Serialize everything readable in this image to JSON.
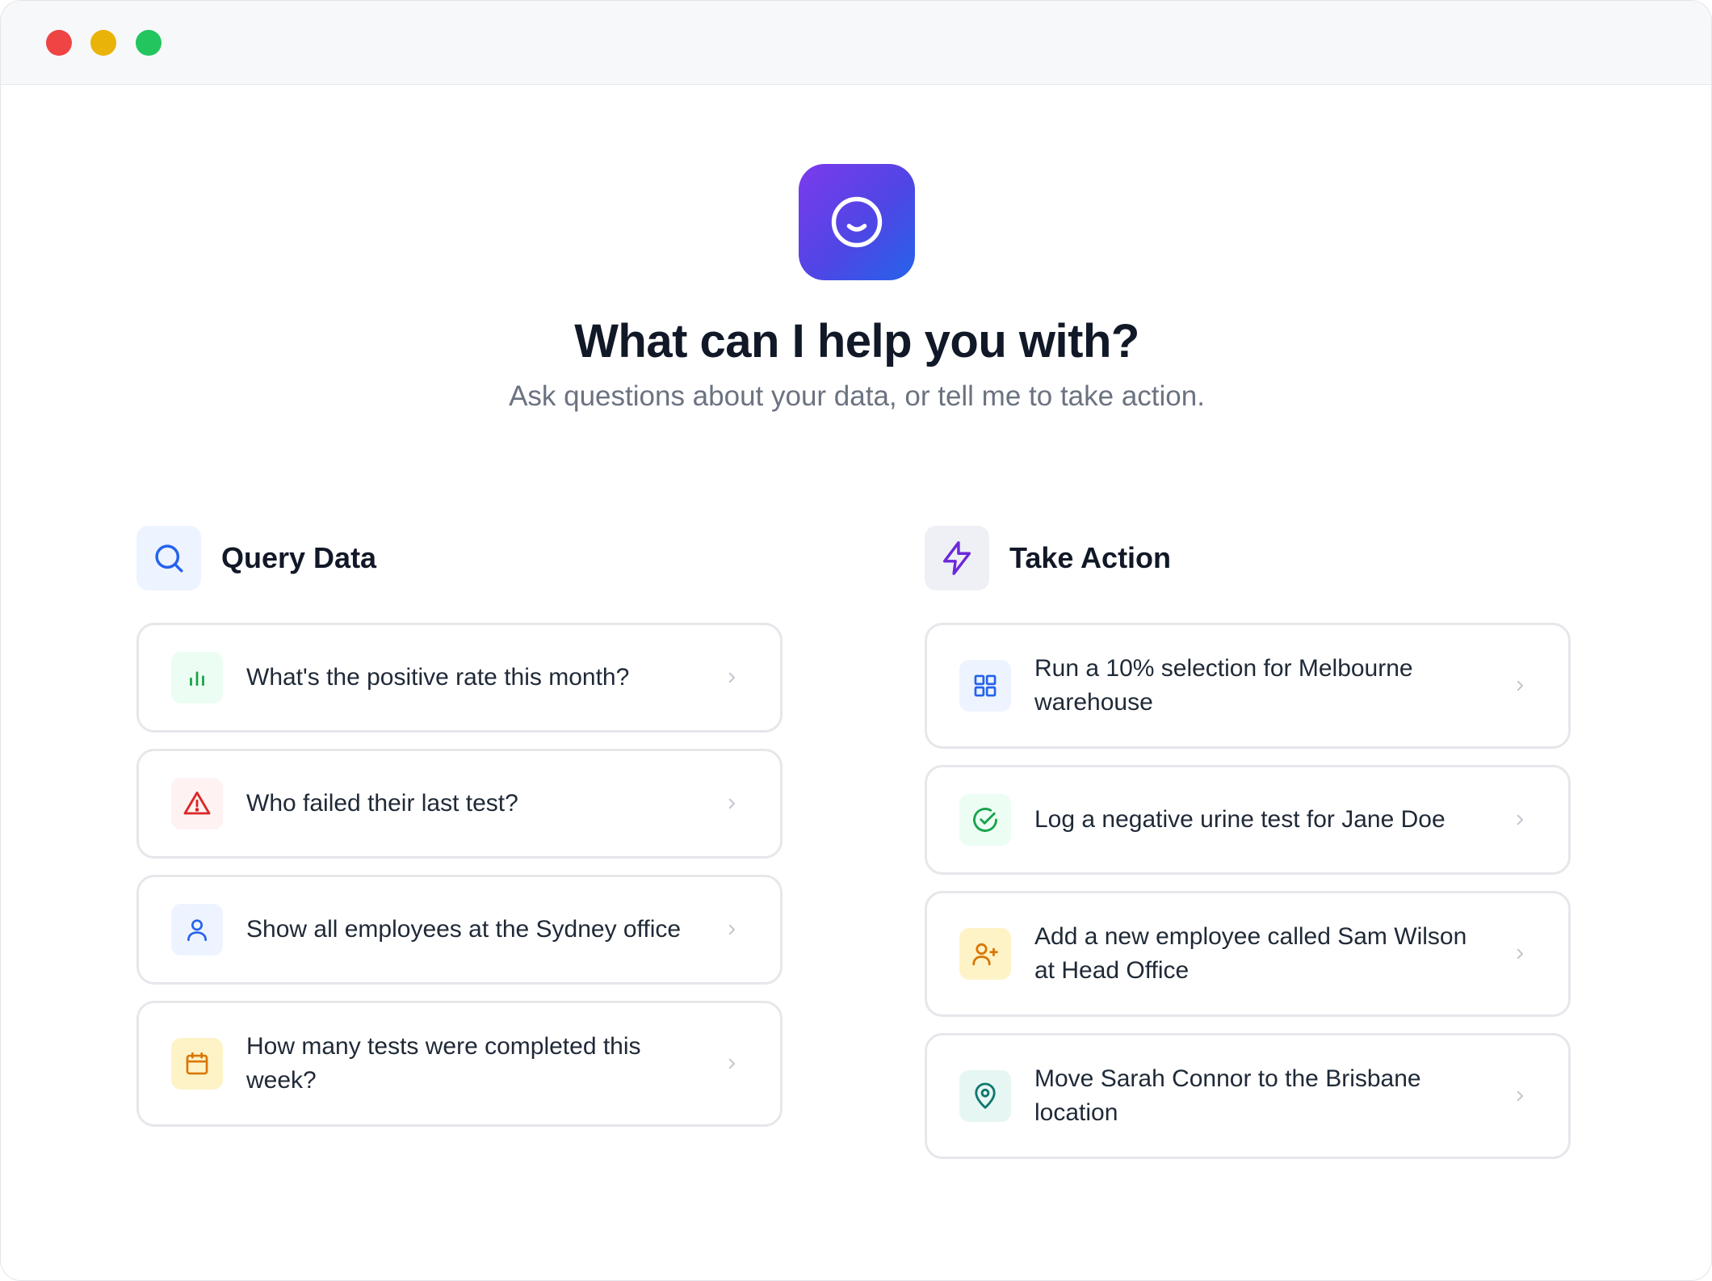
{
  "window": {
    "controls": [
      "close",
      "minimize",
      "maximize"
    ]
  },
  "hero": {
    "logo_icon": "smile-icon",
    "title": "What can I help you with?",
    "subtitle": "Ask questions about your data, or tell me to take action."
  },
  "query": {
    "title": "Query Data",
    "icon": "search-icon",
    "items": [
      {
        "label": "What's the positive rate this month?",
        "icon": "bar-chart-icon",
        "color": "#16a34a",
        "bg": "#ecfdf3"
      },
      {
        "label": "Who failed their last test?",
        "icon": "alert-triangle-icon",
        "color": "#dc2626",
        "bg": "#fef2f2"
      },
      {
        "label": "Show all employees at the Sydney office",
        "icon": "user-icon",
        "color": "#2563eb",
        "bg": "#eef4ff"
      },
      {
        "label": "How many tests were completed this week?",
        "icon": "calendar-icon",
        "color": "#d97706",
        "bg": "#fef3c7"
      }
    ]
  },
  "action": {
    "title": "Take Action",
    "icon": "lightning-icon",
    "items": [
      {
        "label": "Run a 10% selection for Melbourne warehouse",
        "icon": "grid-icon",
        "color": "#2563eb",
        "bg": "#eef4ff"
      },
      {
        "label": "Log a negative urine test for Jane Doe",
        "icon": "check-circle-icon",
        "color": "#16a34a",
        "bg": "#ecfdf3"
      },
      {
        "label": "Add a new employee called Sam Wilson at Head Office",
        "icon": "user-plus-icon",
        "color": "#d97706",
        "bg": "#fef3c7"
      },
      {
        "label": "Move Sarah Connor to the Brisbane location",
        "icon": "map-pin-icon",
        "color": "#0f766e",
        "bg": "#e6f6f3"
      }
    ]
  },
  "colors": {
    "accent_purple": "#7c3aed",
    "accent_blue": "#2563eb",
    "border": "#e5e7eb",
    "text_primary": "#111827",
    "text_secondary": "#6b7280"
  }
}
